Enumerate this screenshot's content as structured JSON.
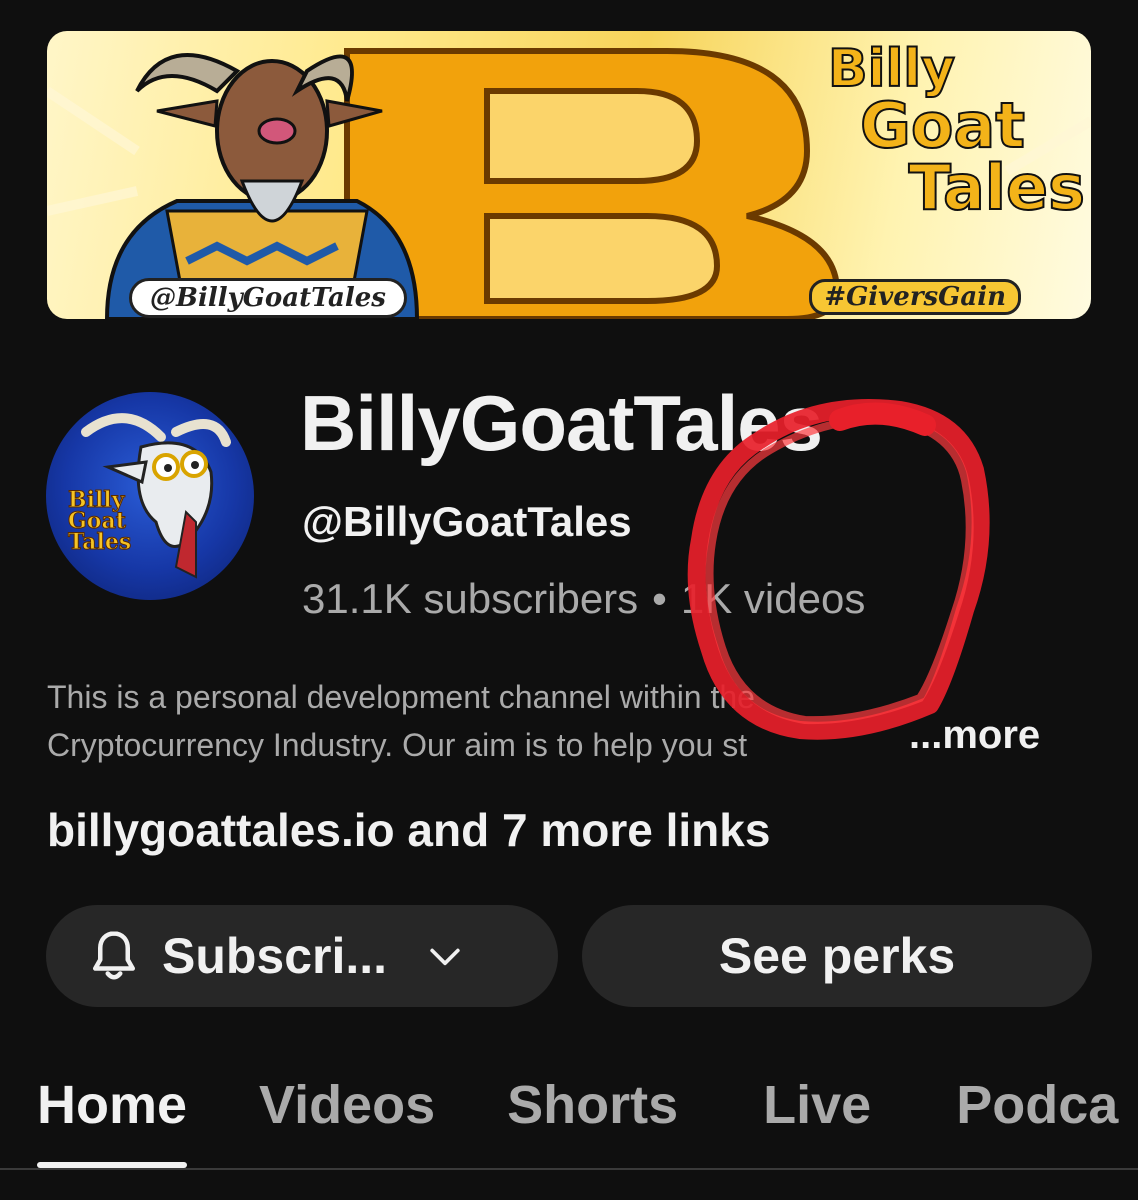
{
  "banner": {
    "title_lines": [
      "Billy",
      "Goat",
      "Tales"
    ],
    "handle_tag": "@BillyGoatTales",
    "hashtag": "#GiversGain"
  },
  "avatar": {
    "text_lines": [
      "Billy",
      "Goat",
      "Tales"
    ]
  },
  "channel": {
    "name": "BillyGoatTales",
    "handle": "@BillyGoatTales",
    "subscribers": "31.1K subscribers",
    "separator": "•",
    "videos": "1K videos"
  },
  "description": {
    "line1": "This is a personal development channel within the",
    "line2": "Cryptocurrency Industry. Our aim is to help you st",
    "more": "...more"
  },
  "links": {
    "text": "billygoattales.io and 7 more links"
  },
  "buttons": {
    "subscribe_label": "Subscri...",
    "perks_label": "See perks"
  },
  "tabs": [
    {
      "label": "Home",
      "active": true
    },
    {
      "label": "Videos",
      "active": false
    },
    {
      "label": "Shorts",
      "active": false
    },
    {
      "label": "Live",
      "active": false
    },
    {
      "label": "Podca",
      "active": false
    }
  ],
  "colors": {
    "background": "#0f0f0f",
    "button_bg": "#272727",
    "text_primary": "#f1f1f1",
    "text_secondary": "#aaaaaa",
    "annotation_red": "#e8202a"
  },
  "icons": {
    "subscribe_bell": "bell-icon",
    "subscribe_dropdown": "chevron-down-icon"
  }
}
